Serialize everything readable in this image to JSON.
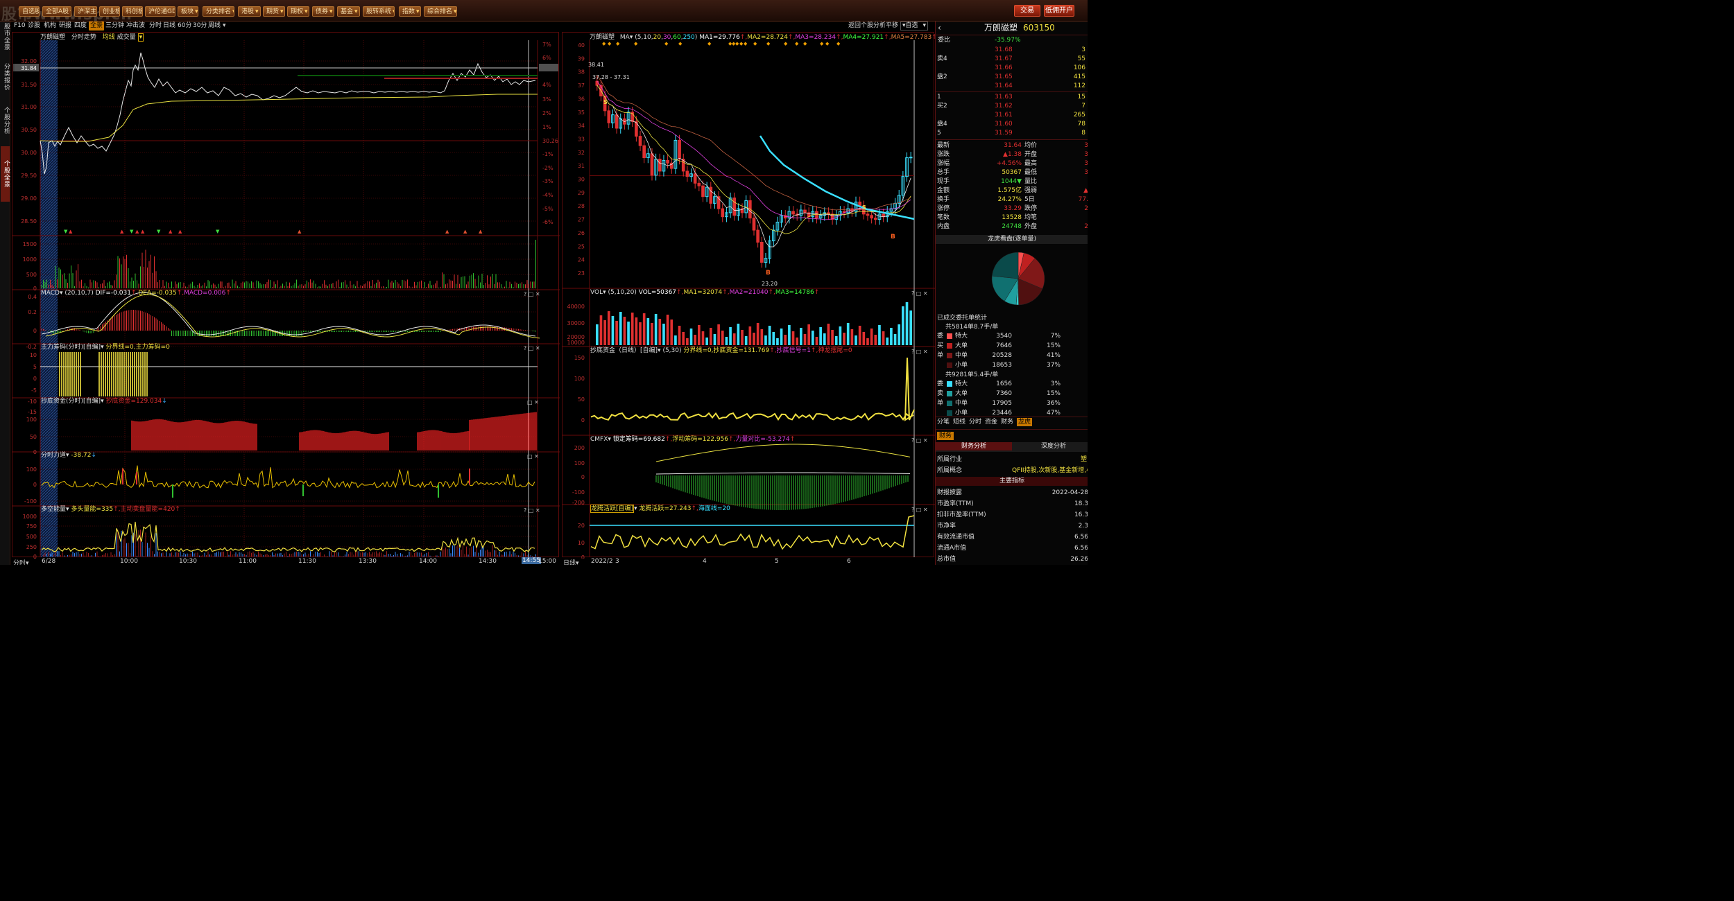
{
  "topbar": {
    "watermark": "股市www.sp.cn",
    "buttons": [
      "自选股",
      "全部A股",
      "沪深主板",
      "创业板",
      "科创板",
      "沪伦通GDR",
      "板块",
      "分类排名",
      "港股",
      "期货",
      "期权",
      "债券",
      "基金",
      "股转系统",
      "指数",
      "综合排名"
    ],
    "trade": "交易",
    "open_account": "低佣开户"
  },
  "sidebar": {
    "tabs": [
      "股市全景",
      "分类报价",
      "个股分析",
      "个股全景"
    ]
  },
  "toolbar": {
    "items": [
      "F10",
      "诊股",
      "机构",
      "研报",
      "四度",
      "全景",
      "三分钟",
      "冲击波",
      "分时",
      "日线",
      "60分",
      "30分",
      "周线"
    ],
    "right": [
      "返回个股分析",
      "平移"
    ],
    "zixuan": "自选"
  },
  "left": {
    "title": {
      "name": "万朗磁塑",
      "mode": "分时走势",
      "avg": "均线",
      "vol": "成交量"
    },
    "yleft": [
      "32.00",
      "31.84",
      "31.50",
      "31.00",
      "30.50",
      "30.00",
      "29.50",
      "29.00",
      "28.50"
    ],
    "yright": [
      "7%",
      "6%",
      "5.2%",
      "4%",
      "3%",
      "2%",
      "1%",
      "30.26",
      "-1%",
      "-2%",
      "-3%",
      "-4%",
      "-5%",
      "-6%"
    ],
    "vol_y": [
      "1500",
      "1000",
      "500",
      "0"
    ],
    "macd": {
      "name": "MACD",
      "params": "(20,10,7)",
      "dif": "DIF=-0.031",
      "dea": "DEA=-0.035",
      "macd": "MACD=0.006",
      "y": [
        "0.4",
        "0.2",
        "0",
        "-0.2"
      ]
    },
    "zlcm": {
      "name": "主力筹码(分时)",
      "tag": "[自编]",
      "line": "分界线=0,主力筹码=0",
      "y": [
        "10",
        "5",
        "0",
        "-5",
        "-10",
        "-15"
      ]
    },
    "cdzj": {
      "name": "抄底资金(分时)",
      "tag": "[自编]",
      "val": "抄底资金=129.034",
      "y": [
        "100",
        "50",
        "0"
      ]
    },
    "fsld": {
      "name": "分时力道",
      "val": "-38.72",
      "y": [
        "100",
        "0",
        "-100"
      ]
    },
    "dkn": {
      "name": "多空能量",
      "bull": "多头量能=335",
      "bear": "主动卖盘量能=420",
      "y": [
        "1000",
        "750",
        "500",
        "250",
        "0"
      ]
    },
    "xaxis": {
      "label": "分时",
      "ticks": [
        "6/28",
        "10:00",
        "10:30",
        "11:00",
        "11:30",
        "13:30",
        "14:00",
        "14:30",
        "14:55",
        "15:00"
      ]
    }
  },
  "middle": {
    "title": {
      "name": "万朗磁塑",
      "ma": "MA",
      "params": "(5,10,20,30,60,250)",
      "ma1": "MA1=29.776",
      "ma2": "MA2=28.724",
      "ma3": "MA3=28.234",
      "ma4": "MA4=27.921",
      "ma5": "MA5=27.783"
    },
    "y": [
      "40",
      "39",
      "38",
      "37",
      "36",
      "35",
      "34",
      "33",
      "32",
      "31",
      "30",
      "29",
      "28",
      "27",
      "26",
      "25",
      "24",
      "23"
    ],
    "ann": {
      "high": "38.41",
      "range": "37.28 - 37.31",
      "low": "23.20",
      "b1": "B",
      "b2": "B",
      "s1": "S",
      "s2": "S"
    },
    "vol": {
      "name": "VOL",
      "params": "(5,10,20)",
      "v": "VOL=50367",
      "ma1": "MA1=32074",
      "ma2": "MA2=21040",
      "ma3": "MA3=14786",
      "y": [
        "40000",
        "30000",
        "20000",
        "10000",
        "K线"
      ]
    },
    "cdzj": {
      "name": "抄底资金（日线）",
      "tag": "[自编]",
      "params": "(5,30)",
      "line": "分界线=0,抄底资金=131.769",
      "sig": "抄底信号=1",
      "dragon": "神龙摆尾=0",
      "y": [
        "150",
        "100",
        "50",
        "0"
      ]
    },
    "cmfx": {
      "name": "CMFX",
      "a": "锁定筹码=69.682",
      "b": "浮动筹码=122.956",
      "c": "力量对比=-53.274",
      "y": [
        "200",
        "100",
        "0",
        "-100",
        "-200"
      ]
    },
    "lthy": {
      "name": "龙腾活跃[自编]",
      "val": "龙腾活跃=27.243",
      "sea": "海面线=20",
      "y": [
        "20",
        "10",
        "0"
      ]
    },
    "xaxis": {
      "label": "日线",
      "ticks": [
        "2022/2",
        "3",
        "4",
        "5",
        "6"
      ]
    }
  },
  "right": {
    "name": "万朗磁塑",
    "code": "603150",
    "weibi": {
      "label": "委比",
      "val": "-35.97%",
      "diff": "-",
      "vol": ""
    },
    "asks": [
      {
        "l": "",
        "p": "31.68",
        "v": "3"
      },
      {
        "l": "卖4",
        "p": "31.67",
        "v": "55"
      },
      {
        "l": "",
        "p": "31.66",
        "v": "106"
      },
      {
        "l": "盘2",
        "p": "31.65",
        "v": "415"
      },
      {
        "l": "",
        "p": "31.64",
        "v": "112"
      }
    ],
    "bids": [
      {
        "l": "1",
        "p": "31.63",
        "v": "15"
      },
      {
        "l": "买2",
        "p": "31.62",
        "v": "7"
      },
      {
        "l": "",
        "p": "31.61",
        "v": "265"
      },
      {
        "l": "盘4",
        "p": "31.60",
        "v": "78"
      },
      {
        "l": "5",
        "p": "31.59",
        "v": "8"
      }
    ],
    "quote": [
      [
        "最新",
        "31.64",
        "均价",
        "3"
      ],
      [
        "涨跌",
        "▲1.38",
        "开盘",
        "3"
      ],
      [
        "涨幅",
        "+4.56%",
        "最高",
        "3"
      ],
      [
        "总手",
        "50367",
        "最低",
        "3"
      ],
      [
        "现手",
        "1044▼",
        "量比",
        ""
      ],
      [
        "金额",
        "1.575亿",
        "强弱",
        "▲"
      ],
      [
        "换手",
        "24.27%",
        "5日",
        "77."
      ],
      [
        "涨停",
        "33.29",
        "跌停",
        "2"
      ],
      [
        "笔数",
        "13528",
        "均笔",
        ""
      ],
      [
        "内盘",
        "24748",
        "外盘",
        "2"
      ]
    ],
    "lhk": "龙虎看盘(逐单量)",
    "deal": {
      "title": "已成交委托单统计",
      "sell_total": "共5814单8.7手/单",
      "sell": [
        [
          "委",
          "特大",
          "3540",
          "7%"
        ],
        [
          "买",
          "大单",
          "7646",
          "15%"
        ],
        [
          "单",
          "中单",
          "20528",
          "41%"
        ],
        [
          "",
          "小单",
          "18653",
          "37%"
        ]
      ],
      "buy_total": "共9281单5.4手/单",
      "buy": [
        [
          "委",
          "特大",
          "1656",
          "3%"
        ],
        [
          "卖",
          "大单",
          "7360",
          "15%"
        ],
        [
          "单",
          "中单",
          "17905",
          "36%"
        ],
        [
          "",
          "小单",
          "23446",
          "47%"
        ]
      ]
    },
    "tabs": [
      "分笔",
      "短线",
      "分时",
      "资金",
      "财务",
      "龙虎"
    ],
    "cw": "财务",
    "cwfx": "财务分析",
    "sdfx": "深度分析",
    "info": [
      [
        "所属行业",
        "塑"
      ],
      [
        "所属概念",
        "QFII持股,次新股,基金新增,小"
      ]
    ],
    "zyzb": "主要指标",
    "fin": [
      [
        "财报披露",
        "2022-04-28"
      ],
      [
        "市盈率(TTM)",
        "18.3"
      ],
      [
        "扣非市盈率(TTM)",
        "16.3"
      ],
      [
        "市净率",
        "2.3"
      ],
      [
        "有效流通市值",
        "6.56"
      ],
      [
        "流通A市值",
        "6.56"
      ],
      [
        "总市值",
        "26.26"
      ]
    ]
  }
}
